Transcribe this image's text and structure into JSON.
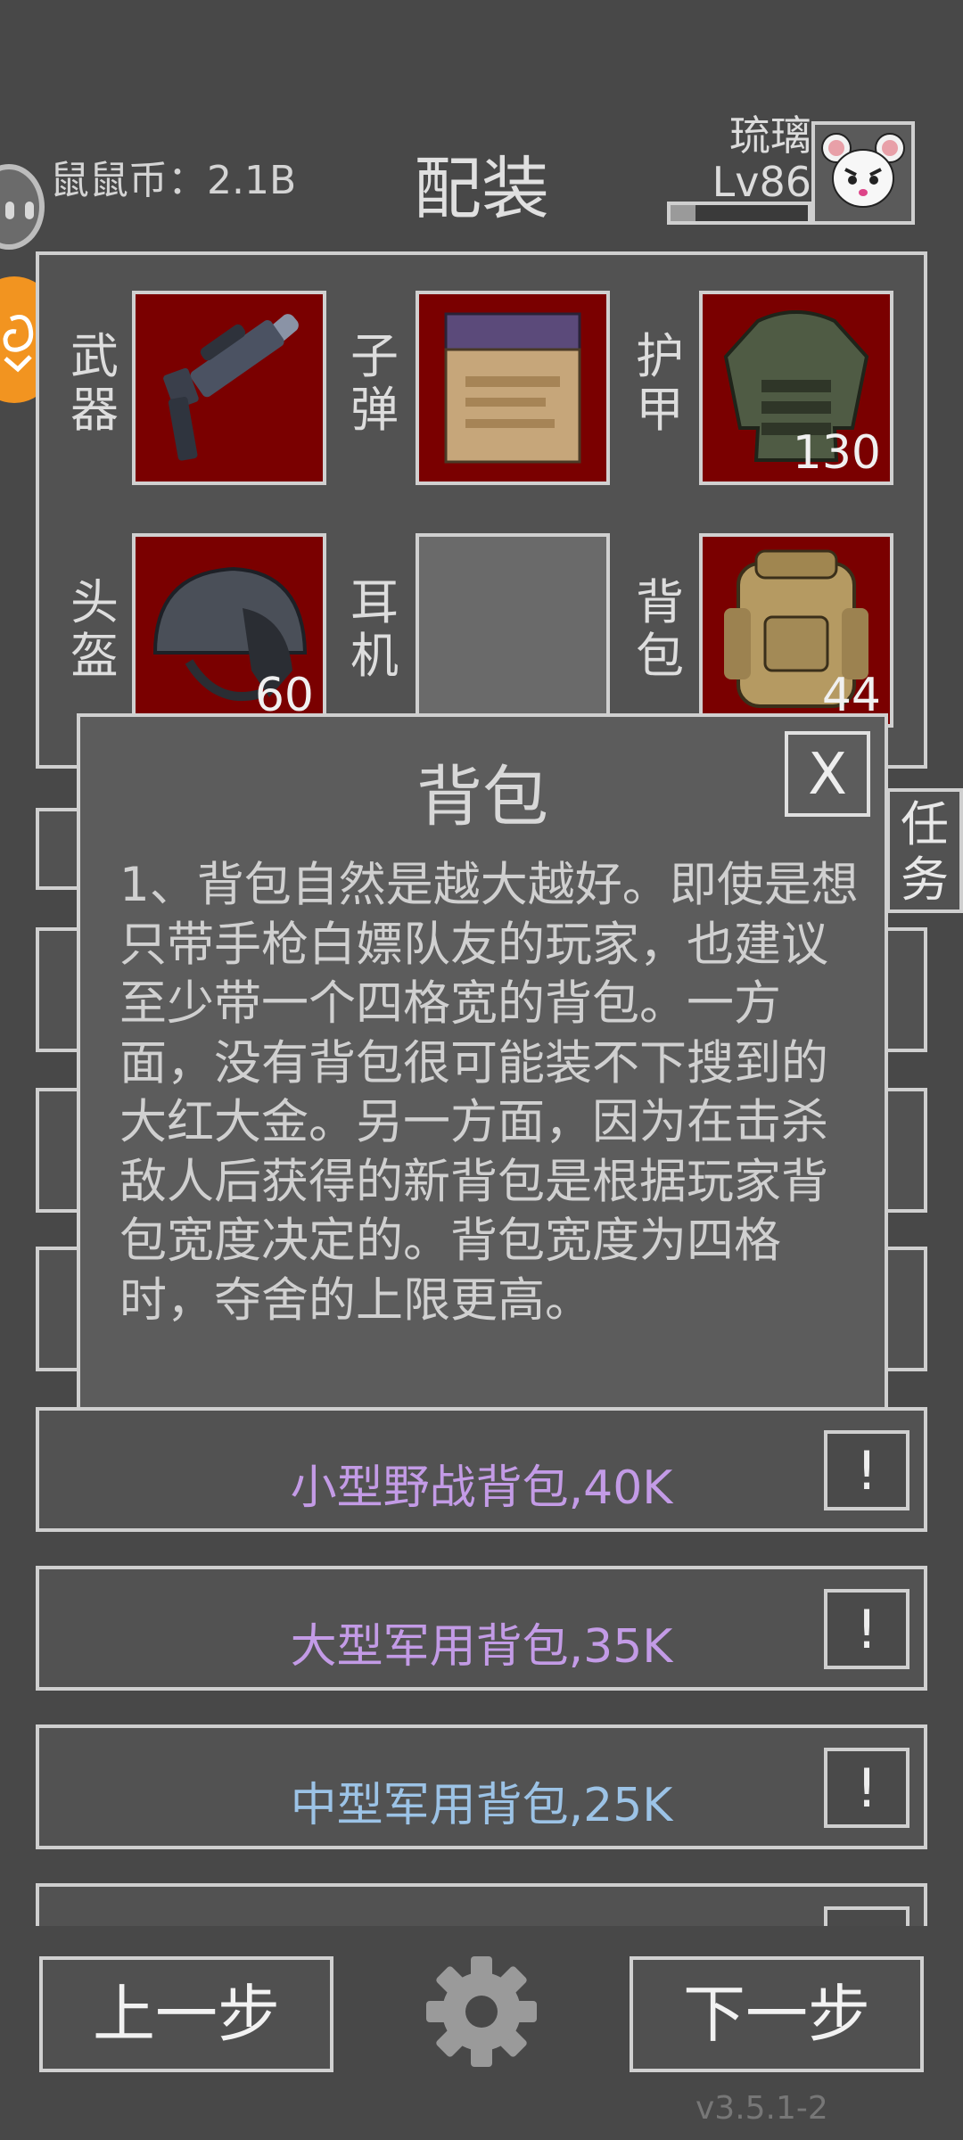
{
  "header": {
    "coins_label": "鼠鼠币：2.1B",
    "title": "配装",
    "player_name": "琉璃",
    "player_level": "Lv86",
    "level_progress": 0.18
  },
  "slots": [
    {
      "label_1": "武",
      "label_2": "器",
      "item_icon": "rifle-icon",
      "count": ""
    },
    {
      "label_1": "子",
      "label_2": "弹",
      "item_icon": "ammo-box-icon",
      "count": ""
    },
    {
      "label_1": "护",
      "label_2": "甲",
      "item_icon": "body-armor-icon",
      "count": "130"
    },
    {
      "label_1": "头",
      "label_2": "盔",
      "item_icon": "helmet-icon",
      "count": "60"
    },
    {
      "label_1": "耳",
      "label_2": "机",
      "item_icon": "",
      "count": ""
    },
    {
      "label_1": "背",
      "label_2": "包",
      "item_icon": "backpack-icon",
      "count": "44"
    }
  ],
  "task_tab": {
    "line_1": "任",
    "line_2": "务"
  },
  "modal": {
    "title": "背包",
    "close_label": "X",
    "body": "1、背包自然是越大越好。即使是想只带手枪白嫖队友的玩家，也建议至少带一个四格宽的背包。一方面，没有背包很可能装不下搜到的大红大金。另一方面，因为在击杀敌人后获得的新背包是根据玩家背包宽度决定的。背包宽度为四格时，夺舍的上限更高。"
  },
  "items": [
    {
      "name": "小型野战背包,40K",
      "color": "#c39be6",
      "info": "!"
    },
    {
      "name": "大型军用背包,35K",
      "color": "#c39be6",
      "info": "!"
    },
    {
      "name": "中型军用背包,25K",
      "color": "#9cc3e6",
      "info": "!"
    }
  ],
  "footer": {
    "prev_label": "上一步",
    "next_label": "下一步",
    "settings_icon": "gear-icon",
    "version": "v3.5.1-2"
  },
  "colors": {
    "background": "#484848",
    "slot_red": "#7a0000",
    "border": "#cfcfcf",
    "orange_bubble": "#f29420"
  }
}
